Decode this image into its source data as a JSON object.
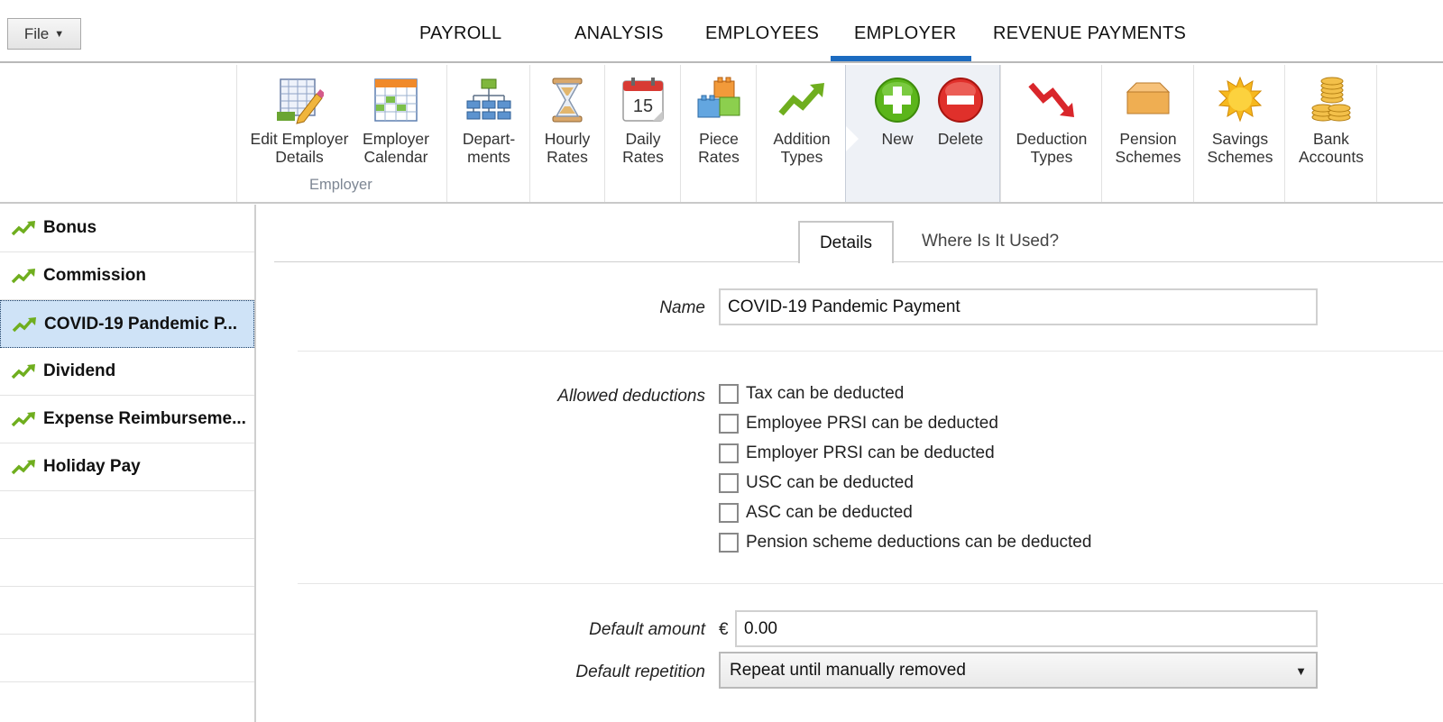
{
  "file_menu": {
    "label": "File",
    "caret": "▼"
  },
  "nav": {
    "tabs": [
      "PAYROLL",
      "ANALYSIS",
      "EMPLOYEES",
      "EMPLOYER",
      "REVENUE PAYMENTS"
    ],
    "active": "EMPLOYER"
  },
  "ribbon": {
    "group_label": "Employer",
    "buttons": {
      "edit_employer": "Edit Employer\nDetails",
      "employer_calendar": "Employer\nCalendar",
      "departments": "Depart-\nments",
      "hourly_rates": "Hourly\nRates",
      "daily_rates": "Daily\nRates",
      "piece_rates": "Piece\nRates",
      "addition_types": "Addition\nTypes",
      "new": "New",
      "delete": "Delete",
      "deduction_types": "Deduction\nTypes",
      "pension_schemes": "Pension\nSchemes",
      "savings_schemes": "Savings\nSchemes",
      "bank_accounts": "Bank\nAccounts"
    },
    "calendar_day": "15"
  },
  "list": {
    "items": [
      "Bonus",
      "Commission",
      "COVID-19 Pandemic P...",
      "Dividend",
      "Expense Reimburseme...",
      "Holiday Pay"
    ],
    "selected_index": 2
  },
  "detail_tabs": [
    "Details",
    "Where Is It Used?"
  ],
  "form": {
    "name_label": "Name",
    "name_value": "COVID-19 Pandemic Payment",
    "allowed_label": "Allowed deductions",
    "checkboxes": [
      "Tax can be deducted",
      "Employee PRSI can be deducted",
      "Employer PRSI can be deducted",
      "USC can be deducted",
      "ASC can be deducted",
      "Pension scheme deductions can be deducted"
    ],
    "default_amount_label": "Default amount",
    "currency": "€",
    "default_amount_value": "0.00",
    "default_repetition_label": "Default repetition",
    "default_repetition_value": "Repeat until manually removed",
    "select_caret": "▼"
  },
  "colors": {
    "accent": "#1c6bc0",
    "selected_row": "#cfe3f7",
    "addition_green": "#6fae1e",
    "new_green": "#5bb51a",
    "delete_red": "#e0302b",
    "deduction_red": "#d9262b"
  },
  "icons": {
    "edit_employer": "grid-pencil-icon",
    "employer_calendar": "calendar-grid-icon",
    "departments": "org-chart-icon",
    "hourly_rates": "hourglass-icon",
    "daily_rates": "calendar-day-icon",
    "piece_rates": "blocks-icon",
    "addition_types": "trend-up-arrow-icon",
    "new": "plus-circle-icon",
    "delete": "minus-circle-icon",
    "deduction_types": "trend-down-arrow-icon",
    "pension_schemes": "box-icon",
    "savings_schemes": "sun-icon",
    "bank_accounts": "coins-icon",
    "list_item": "trend-up-arrow-icon"
  }
}
